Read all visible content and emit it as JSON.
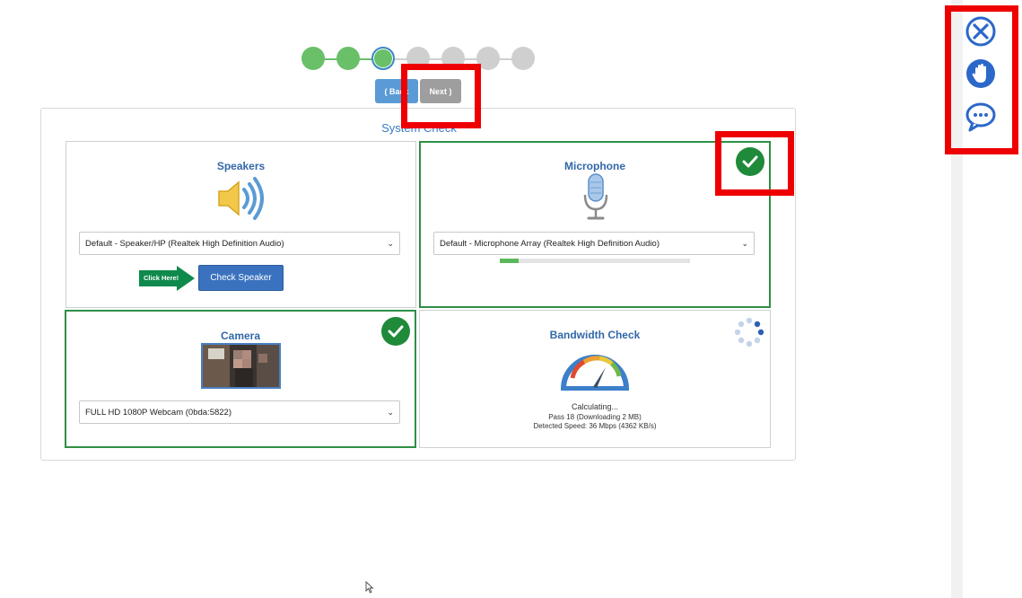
{
  "wizard": {
    "steps": [
      {
        "state": "done"
      },
      {
        "state": "done"
      },
      {
        "state": "current"
      },
      {
        "state": "todo"
      },
      {
        "state": "todo"
      },
      {
        "state": "todo"
      },
      {
        "state": "todo"
      }
    ],
    "back_label": "( Back",
    "next_label": "Next  )"
  },
  "panel": {
    "title": "System Check"
  },
  "speakers": {
    "title": "Speakers",
    "device": "Default - Speaker/HP (Realtek High Definition Audio)",
    "click_here": "Click Here!",
    "check_button": "Check Speaker",
    "icon": "speaker-icon"
  },
  "microphone": {
    "title": "Microphone",
    "device": "Default - Microphone Array (Realtek High Definition Audio)",
    "level": 0.1,
    "status": "ok",
    "icon": "microphone-icon"
  },
  "camera": {
    "title": "Camera",
    "device": "FULL HD 1080P Webcam (0bda:5822)",
    "status": "ok"
  },
  "bandwidth": {
    "title": "Bandwidth Check",
    "status_text": "Calculating...",
    "pass_text": "Pass 18 (Downloading 2 MB)",
    "speed_text": "Detected Speed: 36 Mbps (4362 KB/s)",
    "icon": "speedometer-icon"
  },
  "sidebar": {
    "icons": [
      "close-icon",
      "raise-hand-icon",
      "chat-icon"
    ]
  },
  "colors": {
    "accent": "#3a72bf",
    "success": "#1e8a3a",
    "highlight": "#ee0000"
  }
}
